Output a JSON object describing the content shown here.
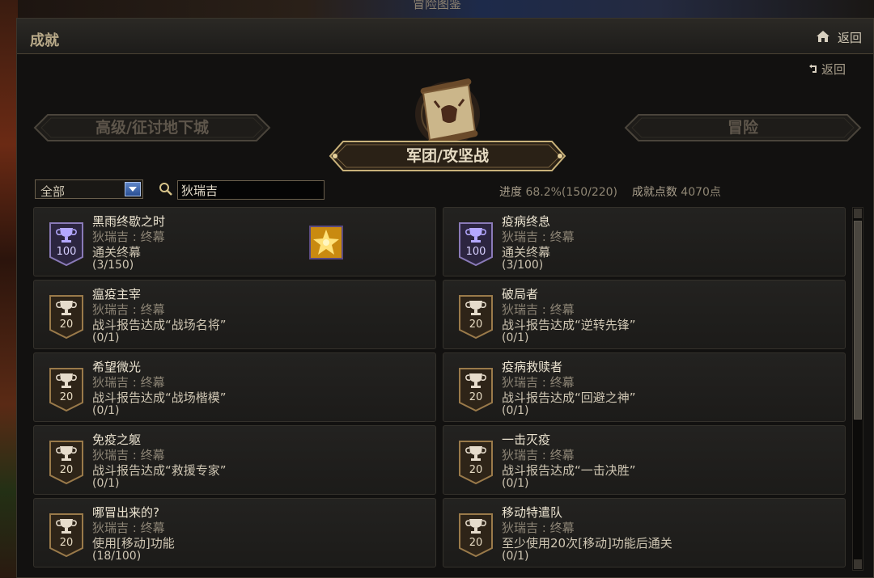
{
  "window": {
    "top_title": "冒险图鉴"
  },
  "header": {
    "title": "成就",
    "home_back_label": "返回",
    "inner_back_label": "返回"
  },
  "categories": {
    "left": "高级/征讨地下城",
    "center": "军团/攻坚战",
    "right": "冒险"
  },
  "filter": {
    "select_value": "全部",
    "search_value": "狄瑞吉",
    "progress_label": "进度",
    "progress_value": "68.2%(150/220)",
    "points_label": "成就点数",
    "points_value": "4070点",
    "progress_fraction": 0.682
  },
  "achievements": [
    {
      "name": "黑雨终歇之时",
      "sub": "狄瑞吉 : 终幕",
      "desc": "通关终幕",
      "progress": "(3/150)",
      "points": "100",
      "tier": "gold",
      "has_reward": true
    },
    {
      "name": "疫病终息",
      "sub": "狄瑞吉 : 终幕",
      "desc": "通关终幕",
      "progress": "(3/100)",
      "points": "100",
      "tier": "gold",
      "has_reward": false
    },
    {
      "name": "瘟疫主宰",
      "sub": "狄瑞吉 : 终幕",
      "desc": "战斗报告达成“战场名将”",
      "progress": "(0/1)",
      "points": "20",
      "tier": "bronze",
      "has_reward": false
    },
    {
      "name": "破局者",
      "sub": "狄瑞吉 : 终幕",
      "desc": "战斗报告达成“逆转先锋”",
      "progress": "(0/1)",
      "points": "20",
      "tier": "bronze",
      "has_reward": false
    },
    {
      "name": "希望微光",
      "sub": "狄瑞吉 : 终幕",
      "desc": "战斗报告达成“战场楷模”",
      "progress": "(0/1)",
      "points": "20",
      "tier": "bronze",
      "has_reward": false
    },
    {
      "name": "疫病救赎者",
      "sub": "狄瑞吉 : 终幕",
      "desc": "战斗报告达成“回避之神”",
      "progress": "(0/1)",
      "points": "20",
      "tier": "bronze",
      "has_reward": false
    },
    {
      "name": "免疫之躯",
      "sub": "狄瑞吉 : 终幕",
      "desc": "战斗报告达成“救援专家”",
      "progress": "(0/1)",
      "points": "20",
      "tier": "bronze",
      "has_reward": false
    },
    {
      "name": "一击灭疫",
      "sub": "狄瑞吉 : 终幕",
      "desc": "战斗报告达成“一击决胜”",
      "progress": "(0/1)",
      "points": "20",
      "tier": "bronze",
      "has_reward": false
    },
    {
      "name": "哪冒出来的?",
      "sub": "狄瑞吉 : 终幕",
      "desc": "使用[移动]功能",
      "progress": "(18/100)",
      "points": "20",
      "tier": "bronze",
      "has_reward": false
    },
    {
      "name": "移动特遣队",
      "sub": "狄瑞吉 : 终幕",
      "desc": "至少使用20次[移动]功能后通关",
      "progress": "(0/1)",
      "points": "20",
      "tier": "bronze",
      "has_reward": false
    }
  ],
  "icons": {
    "home": "home-icon",
    "back": "return-arrow-icon",
    "search": "search-icon",
    "dropdown": "chevron-down-icon",
    "trophy": "trophy-icon",
    "reward": "reward-box-icon",
    "emblem": "scroll-emblem-icon"
  },
  "colors": {
    "gold_badge": "#d8d0ff",
    "bronze_badge": "#b8a07a",
    "accent": "#c9b27a"
  }
}
